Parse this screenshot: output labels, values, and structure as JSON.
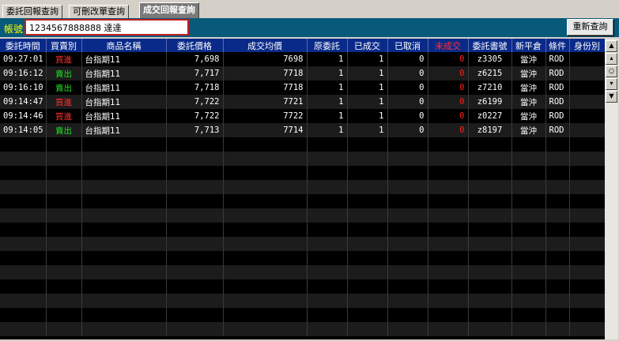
{
  "tabs": [
    {
      "label": "委託回報查詢",
      "active": false
    },
    {
      "label": "可刪改單查詢",
      "active": false
    },
    {
      "label": "成交回報查詢",
      "active": true
    }
  ],
  "account": {
    "label": "帳號",
    "value": "1234567888888 達達"
  },
  "requery_button": "重新查詢",
  "table": {
    "headers": [
      "委託時間",
      "買賣別",
      "商品名稱",
      "委託價格",
      "成交均價",
      "原委託",
      "已成交",
      "已取消",
      "未成交",
      "委託書號",
      "新平倉",
      "條件",
      "身份別"
    ],
    "rows": [
      [
        "09:27:01",
        "買進",
        "台指期11",
        "7,698",
        "7698",
        "1",
        "1",
        "0",
        "0",
        "z3305",
        "當沖",
        "ROD",
        ""
      ],
      [
        "09:16:12",
        "賣出",
        "台指期11",
        "7,717",
        "7718",
        "1",
        "1",
        "0",
        "0",
        "z6215",
        "當沖",
        "ROD",
        ""
      ],
      [
        "09:16:10",
        "賣出",
        "台指期11",
        "7,718",
        "7718",
        "1",
        "1",
        "0",
        "0",
        "z7210",
        "當沖",
        "ROD",
        ""
      ],
      [
        "09:14:47",
        "買進",
        "台指期11",
        "7,722",
        "7721",
        "1",
        "1",
        "0",
        "0",
        "z6199",
        "當沖",
        "ROD",
        ""
      ],
      [
        "09:14:46",
        "買進",
        "台指期11",
        "7,722",
        "7722",
        "1",
        "1",
        "0",
        "0",
        "z0227",
        "當沖",
        "ROD",
        ""
      ],
      [
        "09:14:05",
        "賣出",
        "台指期11",
        "7,713",
        "7714",
        "1",
        "1",
        "0",
        "0",
        "z8197",
        "當沖",
        "ROD",
        ""
      ]
    ]
  },
  "scrollbar": {
    "icons": [
      "scroll-top-icon",
      "scroll-up-icon",
      "scroll-center-icon",
      "scroll-down-icon",
      "scroll-bottom-icon"
    ]
  },
  "colors": {
    "header_bg": "#0a2a8a",
    "account_bar_bg": "#075a7a",
    "buy": "#ff3030",
    "sell": "#20e020",
    "unfilled": "#ff2020"
  }
}
